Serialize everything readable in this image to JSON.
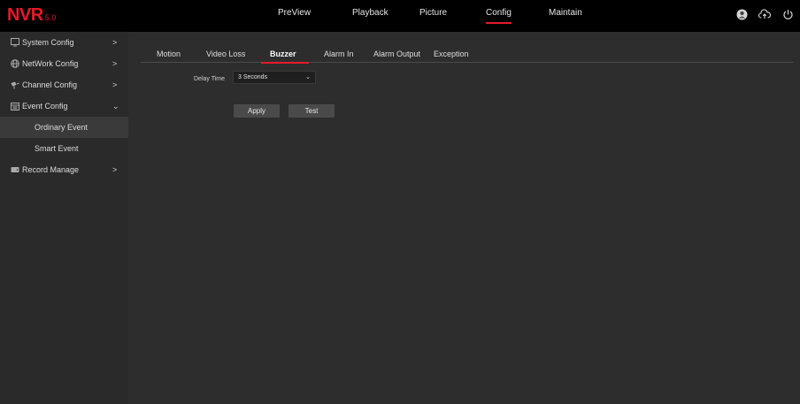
{
  "app": {
    "logo_main": "NVR",
    "logo_version": "5.0"
  },
  "nav": {
    "items": [
      {
        "label": "PreView"
      },
      {
        "label": "Playback"
      },
      {
        "label": "Picture"
      },
      {
        "label": "Config",
        "active": true
      },
      {
        "label": "Maintain"
      }
    ]
  },
  "top_icons": [
    "user-icon",
    "cloud-upload-icon",
    "power-icon"
  ],
  "sidebar": {
    "items": [
      {
        "label": "System Config",
        "arrow": ">",
        "icon": "monitor-icon"
      },
      {
        "label": "NetWork Config",
        "arrow": ">",
        "icon": "globe-icon"
      },
      {
        "label": "Channel Config",
        "arrow": ">",
        "icon": "camera-icon"
      },
      {
        "label": "Event Config",
        "arrow": "⌄",
        "icon": "calendar-icon"
      },
      {
        "label": "Record Manage",
        "arrow": ">",
        "icon": "hdd-icon"
      }
    ],
    "sub_items": [
      {
        "label": "Ordinary Event",
        "active": true
      },
      {
        "label": "Smart Event"
      }
    ]
  },
  "tabs": [
    {
      "label": "Motion"
    },
    {
      "label": "Video Loss"
    },
    {
      "label": "Buzzer",
      "active": true
    },
    {
      "label": "Alarm In"
    },
    {
      "label": "Alarm Output"
    },
    {
      "label": "Exception"
    }
  ],
  "form": {
    "delay_label": "Delay Time",
    "delay_value": "3 Seconds"
  },
  "buttons": {
    "apply": "Apply",
    "test": "Test"
  },
  "colors": {
    "accent": "#e8182a",
    "topbar": "#000000",
    "sidebar": "#2a2a2a",
    "content": "#2d2d2d"
  }
}
